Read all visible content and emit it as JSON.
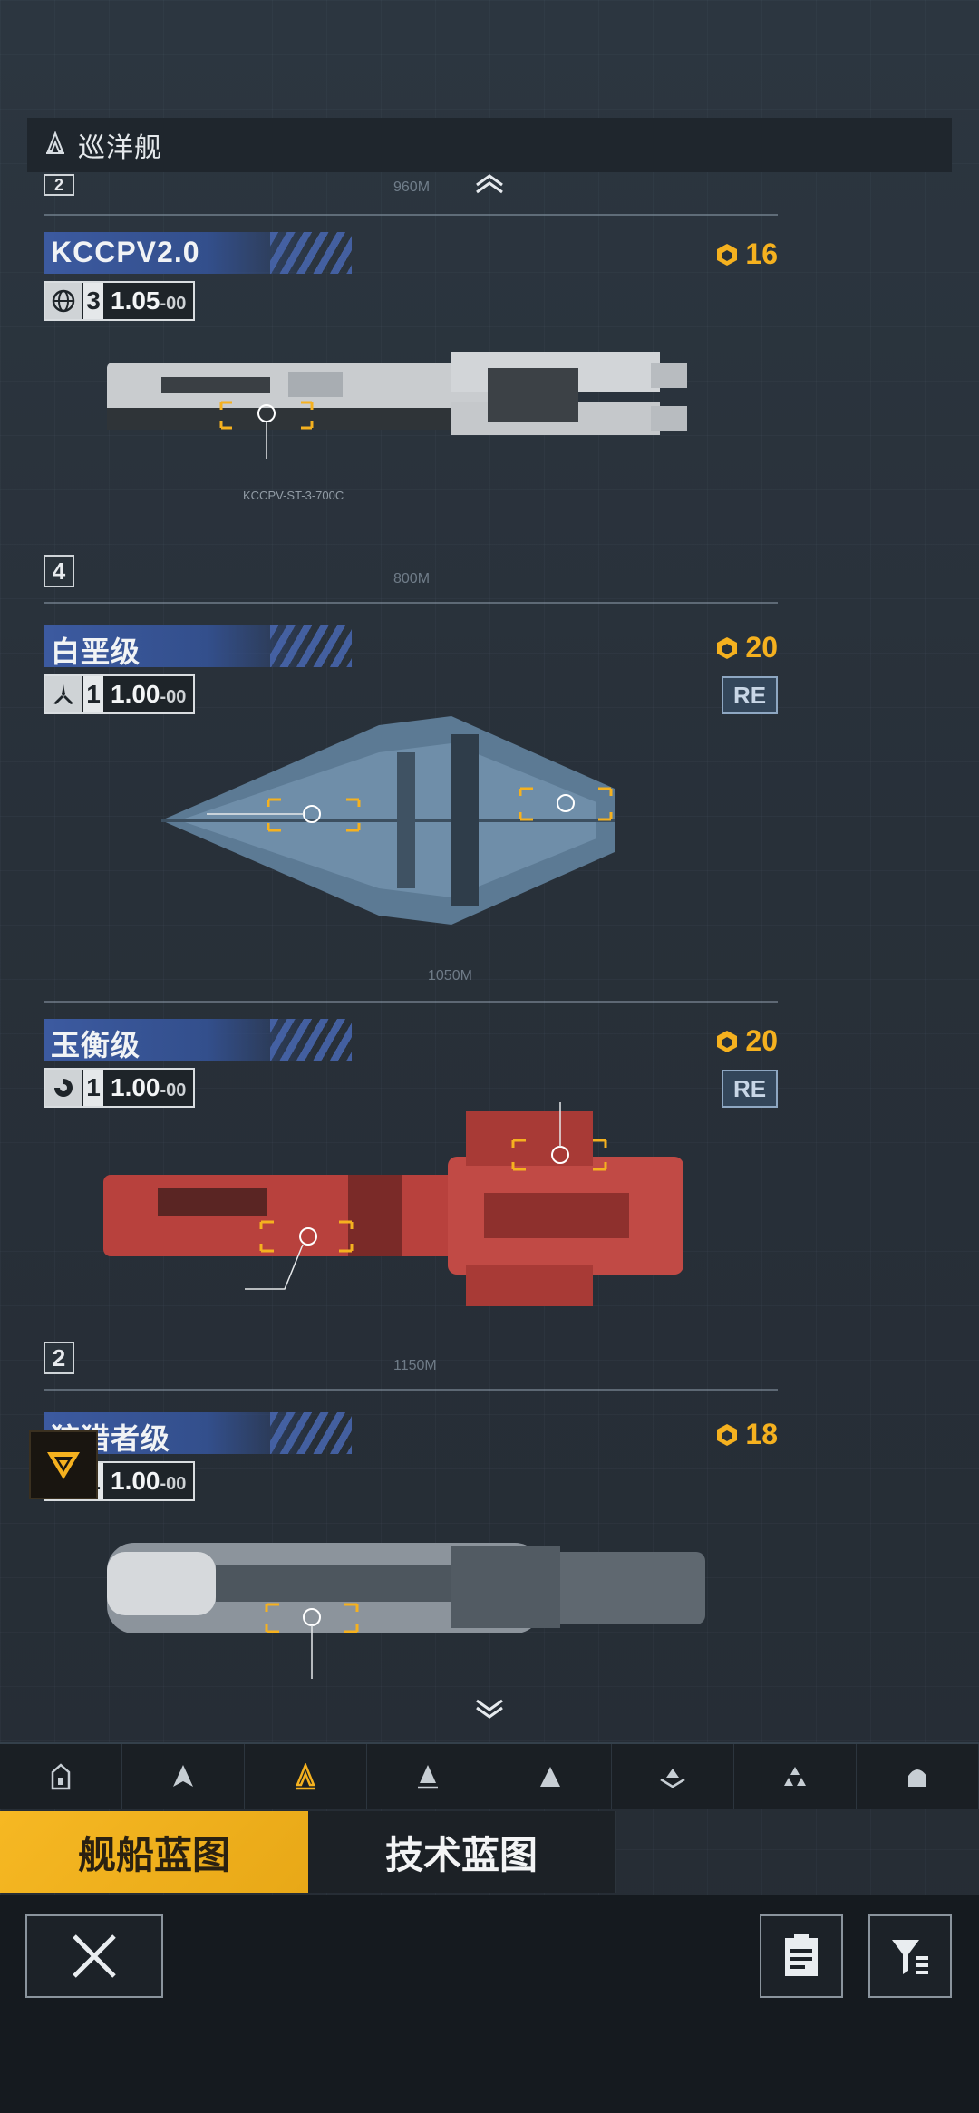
{
  "category": {
    "icon": "cruiser-icon",
    "title": "巡洋舰"
  },
  "ships": [
    {
      "name": "KCCPV2.0",
      "faction_icon": "globe-icon",
      "tier": "3",
      "value_main": "1.05",
      "value_sub": "-00",
      "cost": "16",
      "re": "",
      "grade": "4",
      "length": "800M",
      "designation": "KCCPV-ST-3-700C"
    },
    {
      "name": "白垩级",
      "faction_icon": "tri-blade-icon",
      "tier": "1",
      "value_main": "1.00",
      "value_sub": "-00",
      "cost": "20",
      "re": "RE",
      "grade": "",
      "length": "1050M",
      "designation": ""
    },
    {
      "name": "玉衡级",
      "faction_icon": "swirl-icon",
      "tier": "1",
      "value_main": "1.00",
      "value_sub": "-00",
      "cost": "20",
      "re": "RE",
      "grade": "2",
      "length": "1150M",
      "designation": ""
    },
    {
      "name": "狩猎者级",
      "faction_icon": "",
      "tier": "1",
      "value_main": "1.00",
      "value_sub": "-00",
      "cost": "18",
      "re": "",
      "grade": "",
      "length": "",
      "designation": ""
    }
  ],
  "prev_length": "960M",
  "prev_grade": "2",
  "nav_items": [
    "frigate-icon",
    "destroyer-icon",
    "cruiser-icon",
    "battlecruiser-icon",
    "carrier-icon",
    "auxiliary-icon",
    "fighter-icon",
    "corvette-icon"
  ],
  "tabs": {
    "ship_blueprint": "舰船蓝图",
    "tech_blueprint": "技术蓝图"
  },
  "colors": {
    "accent": "#f5b11f",
    "name_tag": "#3c5aa0",
    "background": "#273038"
  }
}
